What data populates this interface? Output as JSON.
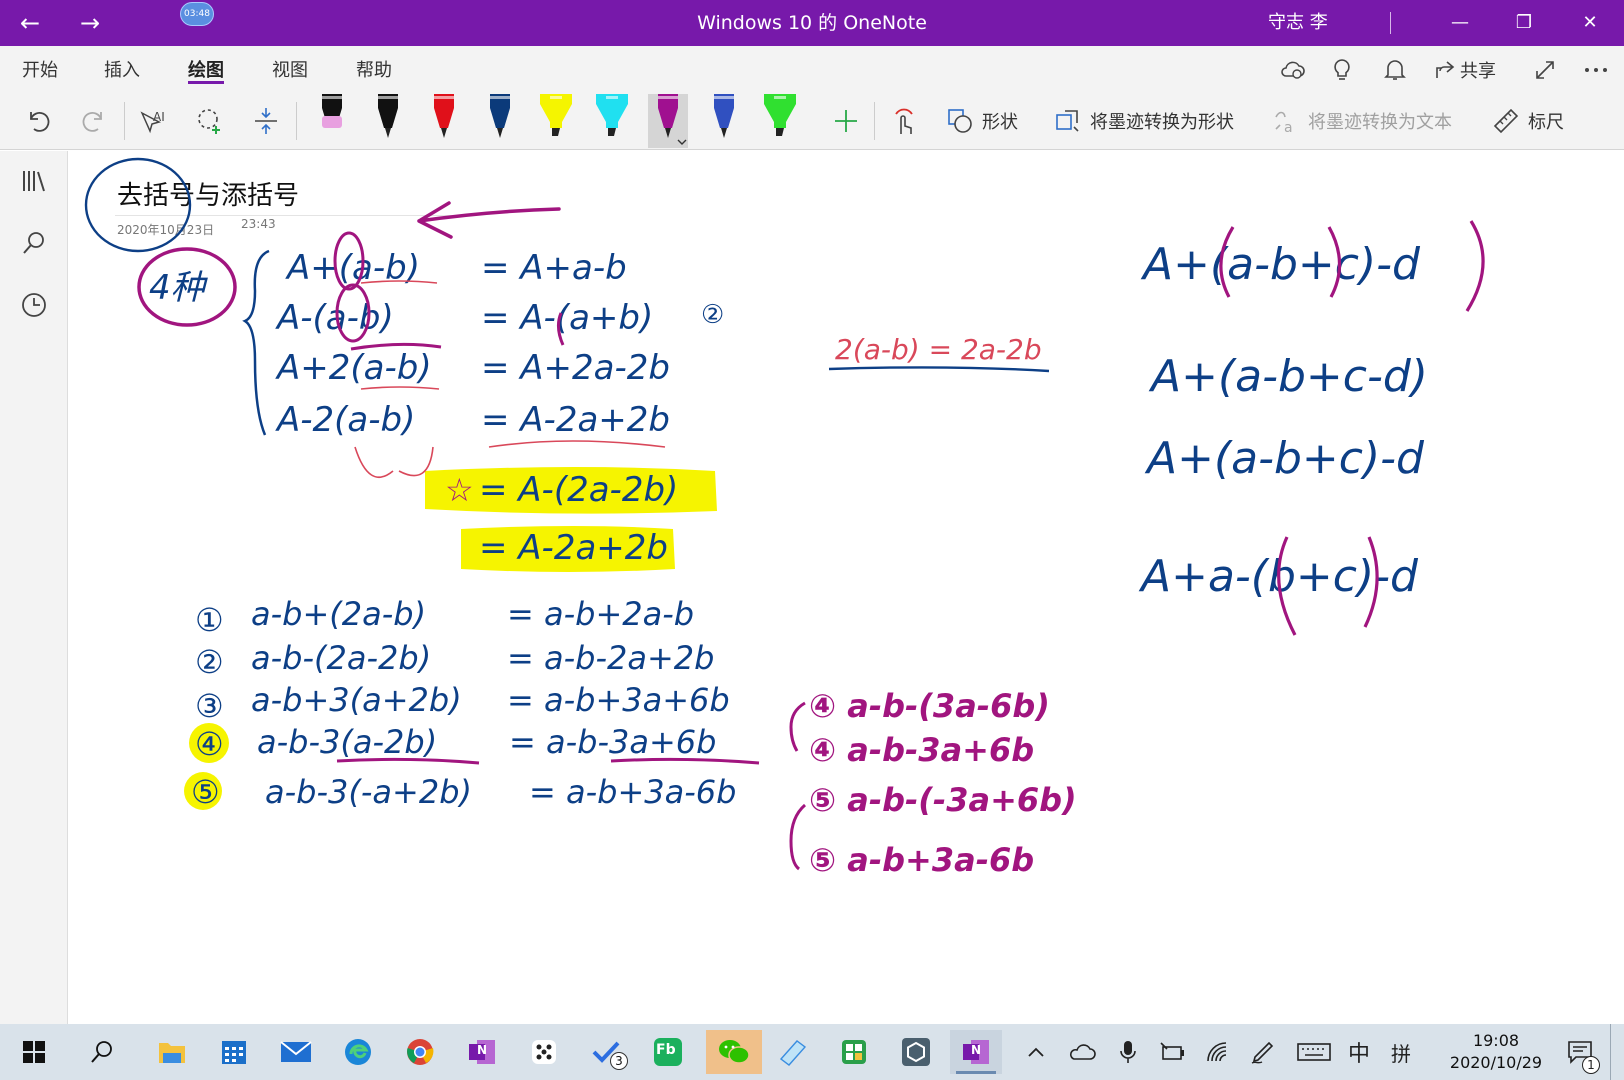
{
  "window": {
    "title": "Windows 10 的 OneNote",
    "user": "守志 李",
    "timer": "03:48",
    "back_glyph": "←",
    "forward_glyph": "→",
    "min_glyph": "—",
    "restore_glyph": "❐",
    "close_glyph": "✕"
  },
  "menu": {
    "tabs": [
      "开始",
      "插入",
      "绘图",
      "视图",
      "帮助"
    ],
    "active_tab": "绘图",
    "share_label": "共享"
  },
  "toolbar": {
    "shapes_label": "形状",
    "ink_to_shape_label": "将墨迹转换为形状",
    "ink_to_text_label": "将墨迹转换为文本",
    "ruler_label": "标尺",
    "pens": [
      {
        "name": "pen-black-pink",
        "color": "#111111",
        "tip": "#e8a0e0"
      },
      {
        "name": "pen-black",
        "color": "#111111",
        "tip": "#111111"
      },
      {
        "name": "pen-red",
        "color": "#e0101a",
        "tip": "#e0101a"
      },
      {
        "name": "pen-navy",
        "color": "#0b3a7a",
        "tip": "#0b3a7a"
      },
      {
        "name": "highlighter-yellow",
        "color": "#f5f500",
        "tip": "#f5f500"
      },
      {
        "name": "highlighter-cyan",
        "color": "#20e0f0",
        "tip": "#20e0f0"
      },
      {
        "name": "pen-purple",
        "color": "#a01090",
        "tip": "#a01090"
      },
      {
        "name": "pen-galaxy",
        "color": "#3050c0",
        "tip": "#7090e0"
      },
      {
        "name": "highlighter-green",
        "color": "#30e030",
        "tip": "#30e030"
      }
    ]
  },
  "page": {
    "title": "去括号与添括号",
    "date": "2020年10月23日",
    "time": "23:43"
  },
  "ink": {
    "blue": "#0d3f86",
    "purple": "#a1157f",
    "red": "#d9485a",
    "yellow": "#f6f400",
    "label_four": "4种",
    "star": "☆",
    "eq1": [
      "A+(a-b)",
      "= A+a-b"
    ],
    "eq2": [
      "A-(a-b)",
      "= A-(a+b)"
    ],
    "eq3": [
      "A+2(a-b)",
      "= A+2a-2b"
    ],
    "eq4": [
      "A-2(a-b)",
      "= A-2a+2b"
    ],
    "hl1": "= A-(2a-2b)",
    "hl2": "= A-2a+2b",
    "mark2": "②",
    "side_note": "2(a-b) = 2a-2b",
    "ex": [
      [
        "①",
        "a-b+(2a-b)",
        "= a-b+2a-b"
      ],
      [
        "②",
        "a-b-(2a-2b)",
        "= a-b-2a+2b"
      ],
      [
        "③",
        "a-b+3(a+2b)",
        "= a-b+3a+6b"
      ],
      [
        "④",
        "a-b-3(a-2b)",
        "= a-b-3a+6b"
      ],
      [
        "⑤",
        "a-b-3(-a+2b)",
        "= a-b+3a-6b"
      ]
    ],
    "p4a": "④ a-b-(3a-6b)",
    "p4b": "④ a-b-3a+6b",
    "p5a": "⑤ a-b-(-3a+6b)",
    "p5b": "⑤ a-b+3a-6b",
    "r1": "A+(a-b+c)-d",
    "r2": "A+(a-b+c-d)",
    "r3": "A+(a-b+c)-d",
    "r4": "A+a-(b+c)-d"
  },
  "taskbar": {
    "onenote_badge": "N",
    "todo_badge": "3",
    "fb_label": "Fb",
    "ime_mode": "中",
    "ime_layout": "拼",
    "time": "19:08",
    "date": "2020/10/29",
    "notif_count": "1"
  }
}
